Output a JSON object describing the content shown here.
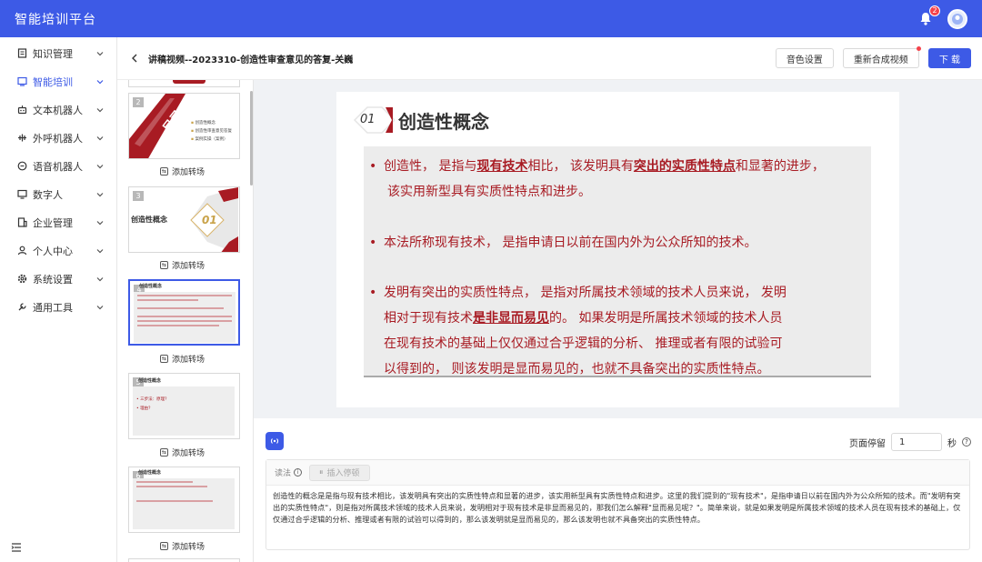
{
  "app": {
    "title": "智能培训平台",
    "notification_count": "2"
  },
  "sidebar": {
    "items": [
      {
        "label": "知识管理",
        "icon": "document-icon",
        "active": false
      },
      {
        "label": "智能培训",
        "icon": "slides-icon",
        "active": true
      },
      {
        "label": "文本机器人",
        "icon": "robot-icon",
        "active": false
      },
      {
        "label": "外呼机器人",
        "icon": "phone-call-icon",
        "active": false
      },
      {
        "label": "语音机器人",
        "icon": "chat-voice-icon",
        "active": false
      },
      {
        "label": "数字人",
        "icon": "monitor-icon",
        "active": false
      },
      {
        "label": "企业管理",
        "icon": "building-icon",
        "active": false
      },
      {
        "label": "个人中心",
        "icon": "user-icon",
        "active": false
      },
      {
        "label": "系统设置",
        "icon": "gear-icon",
        "active": false
      },
      {
        "label": "通用工具",
        "icon": "tool-icon",
        "active": false
      }
    ]
  },
  "header": {
    "title": "讲稿视频--2023310-创造性审查意见的答复-关巍",
    "voice_btn": "音色设置",
    "resynth_btn": "重新合成视频",
    "download_btn": "下 载"
  },
  "thumbnails": {
    "add_transition": "添加转场",
    "items": [
      {
        "num": "2",
        "title": "目录",
        "contents": "CONTENTS",
        "lines": [
          "创造性概念",
          "创造性审查意见答复",
          "案例实操（案例）"
        ]
      },
      {
        "num": "3",
        "title": "创造性概念",
        "badge": "01"
      },
      {
        "num": "4",
        "title": "创造性概念"
      },
      {
        "num": "5",
        "title": "创造性概念",
        "lines": [
          "三步法：原理？",
          "理由？"
        ]
      },
      {
        "num": "6",
        "title": "创造性概念"
      }
    ]
  },
  "slide": {
    "badge": "01",
    "title": "创造性概念",
    "bullets": [
      {
        "p1": "创造性， 是指与",
        "h1": "现有技术",
        "p2": "相比， 该发明具有",
        "h2": "突出的实质性特点",
        "p3": "和显著的进步，",
        "line2": "该实用新型具有实质性特点和进步。"
      },
      {
        "text": "本法所称现有技术， 是指申请日以前在国内外为公众所知的技术。"
      },
      {
        "p1": "发明有突出的实质性特点， 是指对所属技术领域的技术人员来说， 发明",
        "p2": "相对于现有技术",
        "h1": "是非显而易见",
        "p3": "的。 如果发明是所属技术领域的技术人员",
        "line3": "在现有技术的基础上仅仅通过合乎逻辑的分析、 推理或者有限的试验可",
        "line4": "以得到的， 则该发明是显而易见的，也就不具备突出的实质性特点。"
      }
    ]
  },
  "editor": {
    "pause_label": "页面停留",
    "pause_value": "1",
    "pause_unit": "秒",
    "reading_label": "读法",
    "insert_pause": "插入停顿",
    "script_text": "创造性的概念是是指与现有技术相比，该发明具有突出的实质性特点和显著的进步，该实用新型具有实质性特点和进步。这里的我们提到的\"现有技术\"，是指申请日以前在国内外为公众所知的技术。而\"发明有突出的实质性特点\"，则是指对所属技术领域的技术人员来说，发明相对于现有技术是非显而易见的，那我们怎么解释\"显而易见呢？\"。简单来说，就是如果发明是所属技术领域的技术人员在现有技术的基础上，仅仅通过合乎逻辑的分析、推理或者有限的试验可以得到的，那么该发明就是显而易见的，那么该发明也就不具备突出的实质性特点。"
  },
  "colors": {
    "primary": "#3d5ae6",
    "slide_red": "#a81b23",
    "badge_red": "#f5414a"
  }
}
